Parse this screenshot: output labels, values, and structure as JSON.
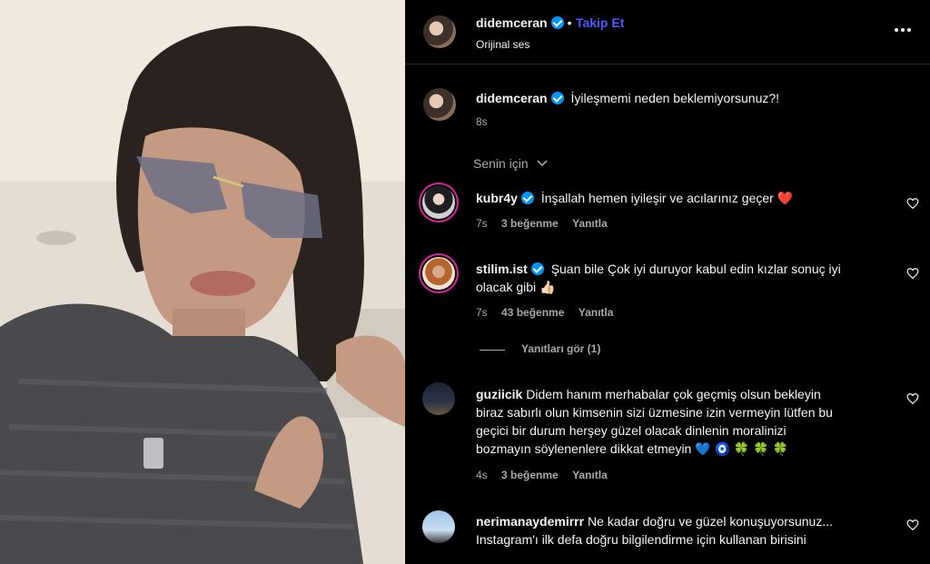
{
  "header": {
    "username": "didemceran",
    "separator": "•",
    "follow_label": "Takip Et",
    "audio": "Orijinal ses",
    "more_icon": "more-horizontal-icon"
  },
  "caption": {
    "username": "didemceran",
    "text": "İyileşmemi neden beklemiyorsunuz?!",
    "time": "8s"
  },
  "filter": {
    "label": "Senin için"
  },
  "comments": [
    {
      "username": "kubr4y",
      "verified": true,
      "lines": [
        "İnşallah hemen iyileşir ve acılarınız geçer ❤️"
      ],
      "time": "7s",
      "likes": "3 beğenme",
      "reply": "Yanıtla"
    },
    {
      "username": "stilim.ist",
      "verified": true,
      "lines": [
        "Şuan bile Çok iyi duruyor kabul edin kızlar sonuç iyi",
        "olacak gibi 👍🏻"
      ],
      "time": "7s",
      "likes": "43 beğenme",
      "reply": "Yanıtla",
      "view_replies": "Yanıtları gör (1)"
    },
    {
      "username": "guziicik",
      "verified": false,
      "lines": [
        "Didem hanım merhabalar çok geçmiş olsun bekleyin",
        "biraz sabırlı olun kimsenin sizi üzmesine izin vermeyin lütfen bu",
        "geçici bir durum herşey güzel olacak dinlenin moralinizi",
        "bozmayın söylenenlere dikkat etmeyin 💙 🧿 🍀 🍀 🍀"
      ],
      "time": "4s",
      "likes": "3 beğenme",
      "reply": "Yanıtla"
    },
    {
      "username": "nerimanaydemirrr",
      "verified": false,
      "lines": [
        "Ne kadar doğru ve güzel konuşuyorsunuz...",
        "Instagram'ı ilk defa doğru bilgilendirme için kullanan birisini"
      ],
      "time": "",
      "likes": "",
      "reply": ""
    }
  ],
  "colors": {
    "accent": "#4c5bff",
    "verified": "#0095f6",
    "heart": "#ed4956"
  }
}
